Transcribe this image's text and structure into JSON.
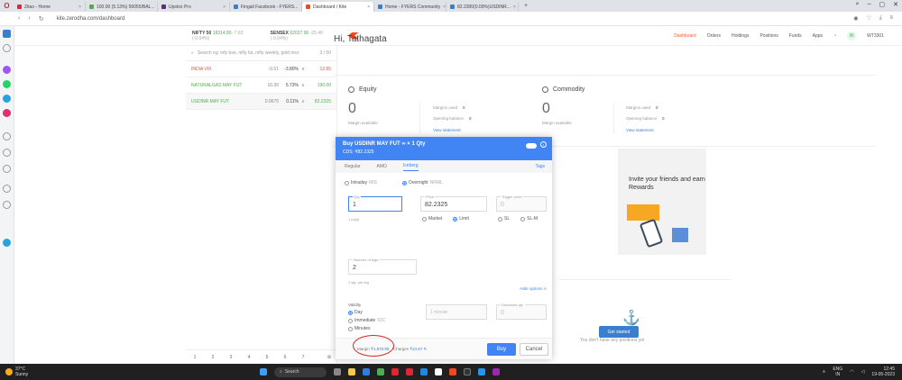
{
  "browser": {
    "tabs": [
      {
        "title": "Zitao - Home",
        "color": "#e0262f"
      },
      {
        "title": "100.00 (5.13%) 56055/BAL...",
        "color": "#4caf50"
      },
      {
        "title": "Upstox Pro",
        "color": "#5a2d82"
      },
      {
        "title": "Fingali Facebook - FYERS...",
        "color": "#387ed1"
      },
      {
        "title": "Dashboard / Kite",
        "color": "#f6461a",
        "active": true
      },
      {
        "title": "Home - FYERS Community",
        "color": "#387ed1"
      },
      {
        "title": "82.2300(0.09%)USDINR...",
        "color": "#387ed1"
      }
    ],
    "url": "kite.zerodha.com/dashboard"
  },
  "indices": [
    {
      "name": "NIFTY 50",
      "value": "18314.80",
      "change": "-7.60 (-0.04%)"
    },
    {
      "name": "SENSEX",
      "value": "62027.96",
      "change": "-25.40 (-0.04%)"
    }
  ],
  "nav": {
    "links": [
      "Dashboard",
      "Orders",
      "Holdings",
      "Positions",
      "Funds",
      "Apps"
    ],
    "user_id": "WT3301",
    "avatar": "W"
  },
  "watchlist": {
    "search_placeholder": "Search eg: infy bse, nifty fut, nifty weekly, gold mcx",
    "count": "3 / 50",
    "items": [
      {
        "symbol": "INDIA VIX",
        "tag": "NSE",
        "change": "-0.51",
        "pct": "-3.80%",
        "arrow": "∨",
        "ltp": "12.85",
        "dir": "down"
      },
      {
        "symbol": "NATURALGAS MAY FUT",
        "tag": "MCX",
        "change": "10.30",
        "pct": "5.73%",
        "arrow": "∧",
        "ltp": "190.00",
        "dir": "up"
      },
      {
        "symbol": "USDINR MAY FUT",
        "tag": "",
        "change": "0.0675",
        "pct": "0.11%",
        "arrow": "∧",
        "ltp": "82.2325",
        "dir": "up"
      }
    ],
    "pages": [
      "1",
      "2",
      "3",
      "4",
      "5",
      "6",
      "7"
    ]
  },
  "dashboard": {
    "greeting": "Hi, Tathagata",
    "equity": {
      "title": "Equity",
      "value": "0",
      "value_label": "Margin available",
      "margins_used_label": "Margins used",
      "margins_used": "0",
      "opening_label": "Opening balance",
      "opening": "0",
      "link": "View statement"
    },
    "commodity": {
      "title": "Commodity",
      "value": "0",
      "value_label": "Margin available",
      "margins_used_label": "Margins used",
      "margins_used": "0",
      "opening_label": "Opening balance",
      "opening": "0",
      "link": "View statement"
    },
    "invite": "Invite your friends and earn Rewards",
    "positions_empty": "You don't have any positions yet",
    "get_started": "Get started"
  },
  "order": {
    "title": "Buy USDINR MAY FUT ∞ × 1 Qty",
    "subtitle": "CDS: ₹82.2325",
    "tabs": [
      "Regular",
      "AMO",
      "Iceberg"
    ],
    "tags": "Tags",
    "product": [
      "Intraday",
      "Overnight"
    ],
    "product_tags": [
      "MIS",
      "NRML"
    ],
    "qty_label": "Qty.",
    "qty": "1",
    "price_label": "Price",
    "price": "82.2325",
    "trigger_label": "Trigger price",
    "trigger": "0",
    "lot_note": "1 lot(s)",
    "order_types": [
      "Market",
      "Limit",
      "SL",
      "SL-M"
    ],
    "legs_label": "Number of legs",
    "legs": "2",
    "legs_note": "1 qty. per leg",
    "hide_options": "Hide options",
    "validity_label": "Validity",
    "validity": [
      "Day",
      "Immediate",
      "Minutes"
    ],
    "validity_tag": "IOC",
    "minutes_value": "1 minute",
    "disclosed_label": "Disclosed qty.",
    "disclosed": "0",
    "margin_label": "Margin",
    "margin": "₹1,870.95",
    "charges_label": "Charges",
    "charges": "₹24.57",
    "buy": "Buy",
    "cancel": "Cancel"
  },
  "taskbar": {
    "temp": "37°C",
    "weather": "Sunny",
    "search": "Search",
    "lang": "ENG",
    "region": "IN",
    "time": "12:45",
    "date": "19-05-2023"
  }
}
